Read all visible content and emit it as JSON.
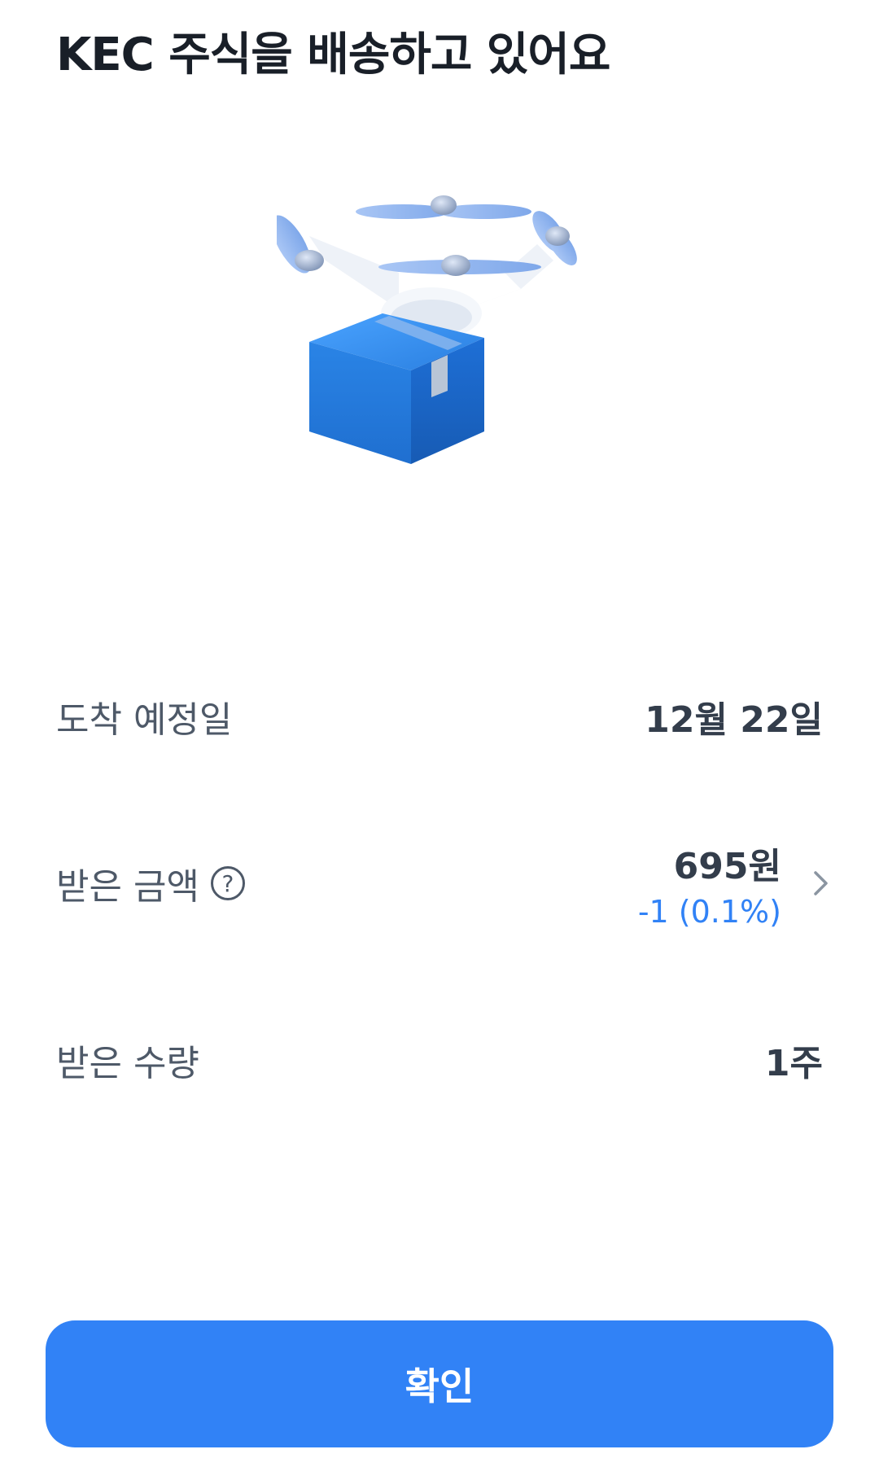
{
  "header": {
    "title": "KEC 주식을 배송하고 있어요"
  },
  "illustration": {
    "icon": "drone-delivering-box-icon",
    "box_color": "#2a84e6",
    "propeller_color": "#8fb4f0"
  },
  "details": {
    "arrival": {
      "label": "도착 예정일",
      "value": "12월 22일"
    },
    "amount": {
      "label": "받은 금액",
      "help_icon": "?",
      "value": "695원",
      "change": "-1 (0.1%)",
      "change_color": "#3182f6"
    },
    "quantity": {
      "label": "받은 수량",
      "value": "1주"
    }
  },
  "footer": {
    "confirm_label": "확인",
    "button_color": "#3182f6"
  }
}
